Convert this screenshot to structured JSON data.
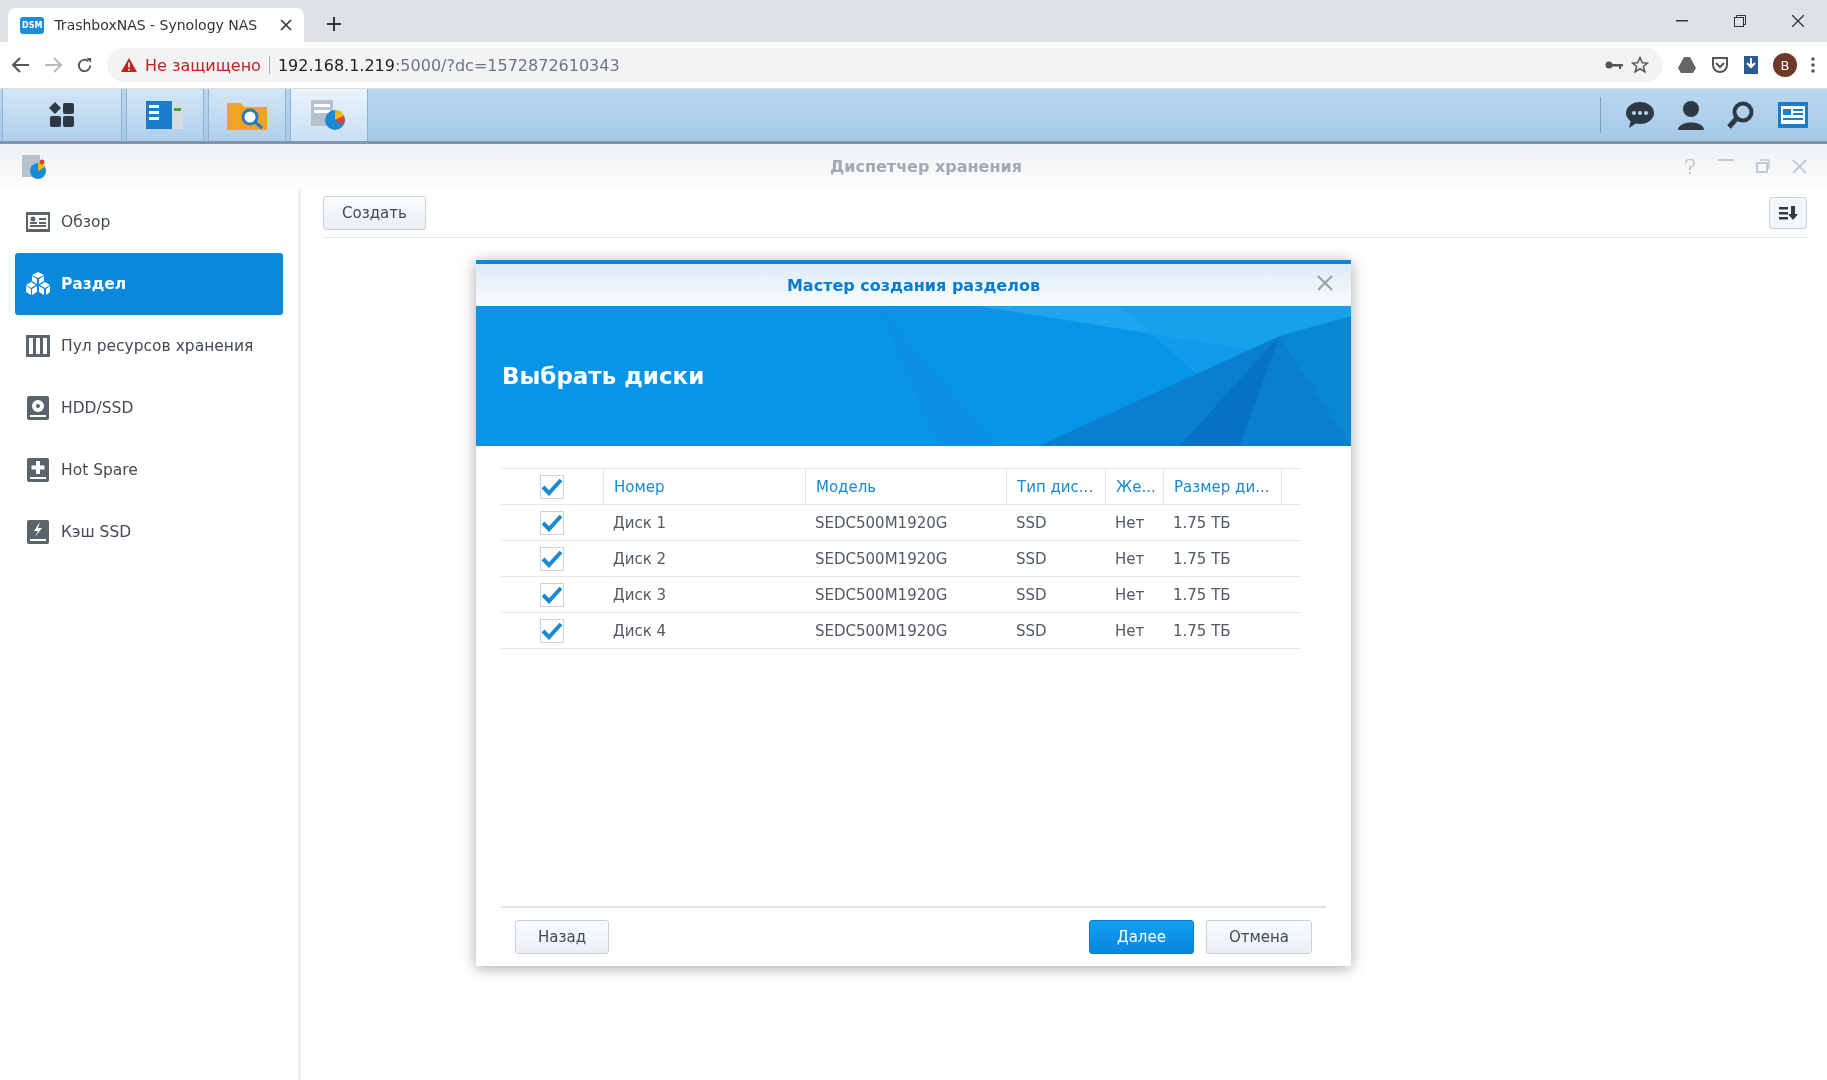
{
  "browser": {
    "tab_title": "TrashboxNAS - Synology NAS",
    "tab_favicon": "DSM",
    "security_warning": "Не защищено",
    "url_host": "192.168.1.219",
    "url_rest": ":5000/?dc=1572872610343",
    "profile_initial": "B"
  },
  "window": {
    "title": "Диспетчер хранения"
  },
  "sidebar": {
    "items": [
      {
        "label": "Обзор",
        "kind": "overview",
        "selected": false
      },
      {
        "label": "Раздел",
        "kind": "volume",
        "selected": true
      },
      {
        "label": "Пул ресурсов хранения",
        "kind": "pool",
        "selected": false
      },
      {
        "label": "HDD/SSD",
        "kind": "disk",
        "selected": false
      },
      {
        "label": "Hot Spare",
        "kind": "spare",
        "selected": false
      },
      {
        "label": "Кэш SSD",
        "kind": "cache",
        "selected": false
      }
    ]
  },
  "toolbar": {
    "create_button": "Создать"
  },
  "dialog": {
    "title": "Мастер создания разделов",
    "heading": "Выбрать диски",
    "table": {
      "all_checked": true,
      "columns": [
        "Номер",
        "Модель",
        "Тип дис...",
        "Же...",
        "Размер ди..."
      ],
      "rows": [
        {
          "checked": true,
          "cells": [
            "Диск 1",
            "SEDC500M1920G",
            "SSD",
            "Нет",
            "1.75 ТБ"
          ]
        },
        {
          "checked": true,
          "cells": [
            "Диск 2",
            "SEDC500M1920G",
            "SSD",
            "Нет",
            "1.75 ТБ"
          ]
        },
        {
          "checked": true,
          "cells": [
            "Диск 3",
            "SEDC500M1920G",
            "SSD",
            "Нет",
            "1.75 ТБ"
          ]
        },
        {
          "checked": true,
          "cells": [
            "Диск 4",
            "SEDC500M1920G",
            "SSD",
            "Нет",
            "1.75 ТБ"
          ]
        }
      ]
    },
    "buttons": [
      {
        "label": "Назад",
        "kind": "secondary"
      },
      {
        "label": "Далее",
        "kind": "primary"
      },
      {
        "label": "Отмена",
        "kind": "secondary"
      }
    ]
  }
}
